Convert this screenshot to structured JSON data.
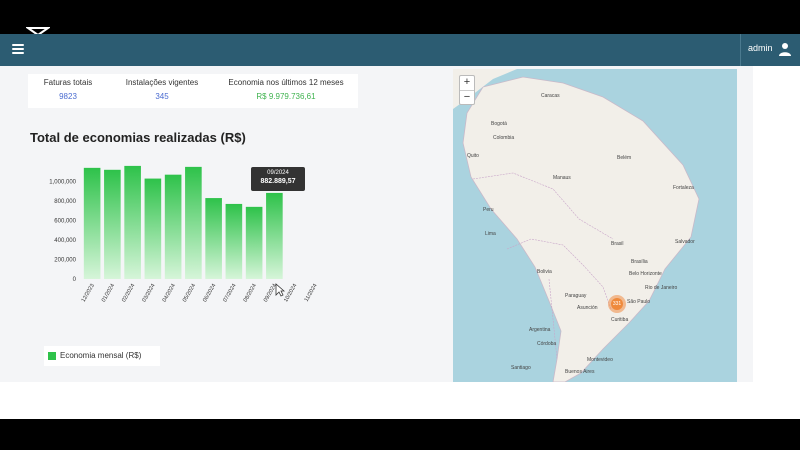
{
  "header": {
    "user_label": "admin"
  },
  "stats": [
    {
      "label": "Faturas totais",
      "value": "9823"
    },
    {
      "label": "Instalações vigentes",
      "value": "345"
    },
    {
      "label": "Economia nos últimos 12 meses",
      "value": "R$ 9.979.736,61"
    }
  ],
  "chart": {
    "title": "Total de economias realizadas (R$)"
  },
  "tooltip": {
    "date": "09/2024",
    "value": "882.889,57"
  },
  "legend": {
    "label": "Economia mensal (R$)"
  },
  "map": {
    "zoom_in": "+",
    "zoom_out": "−",
    "cluster_count": "331",
    "places": [
      {
        "name": "Caracas"
      },
      {
        "name": "Bogotá"
      },
      {
        "name": "Quito"
      },
      {
        "name": "Manaus"
      },
      {
        "name": "Belém"
      },
      {
        "name": "Fortaleza"
      },
      {
        "name": "Lima"
      },
      {
        "name": "Brasil"
      },
      {
        "name": "Bolivia"
      },
      {
        "name": "Salvador"
      },
      {
        "name": "Brasília"
      },
      {
        "name": "Belo Horizonte"
      },
      {
        "name": "Paraguay"
      },
      {
        "name": "Asunción"
      },
      {
        "name": "São Paulo"
      },
      {
        "name": "Rio de Janeiro"
      },
      {
        "name": "Curitiba"
      },
      {
        "name": "Córdoba"
      },
      {
        "name": "Santiago"
      },
      {
        "name": "Buenos Aires"
      },
      {
        "name": "Montevideo"
      },
      {
        "name": "Argentina"
      },
      {
        "name": "Peru"
      },
      {
        "name": "Colombia"
      }
    ]
  },
  "chart_data": {
    "type": "bar",
    "title": "Total de economias realizadas (R$)",
    "categories": [
      "12/2023",
      "01/2024",
      "02/2024",
      "03/2024",
      "04/2024",
      "05/2024",
      "06/2024",
      "07/2024",
      "08/2024",
      "09/2024",
      "10/2024",
      "11/2024"
    ],
    "series": [
      {
        "name": "Economia mensal (R$)",
        "values": [
          1140000,
          1120000,
          1160000,
          1030000,
          1070000,
          1150000,
          830000,
          770000,
          740000,
          882889.57,
          0,
          0
        ]
      }
    ],
    "yticks": [
      0,
      200000,
      400000,
      600000,
      800000,
      1000000
    ],
    "ytick_labels": [
      "0",
      "200,000",
      "400,000",
      "600,000",
      "800,000",
      "1,000,000"
    ],
    "ylim": [
      0,
      1200000
    ],
    "color": "#2ec24a",
    "legend_position": "bottom-left",
    "grid": false
  }
}
